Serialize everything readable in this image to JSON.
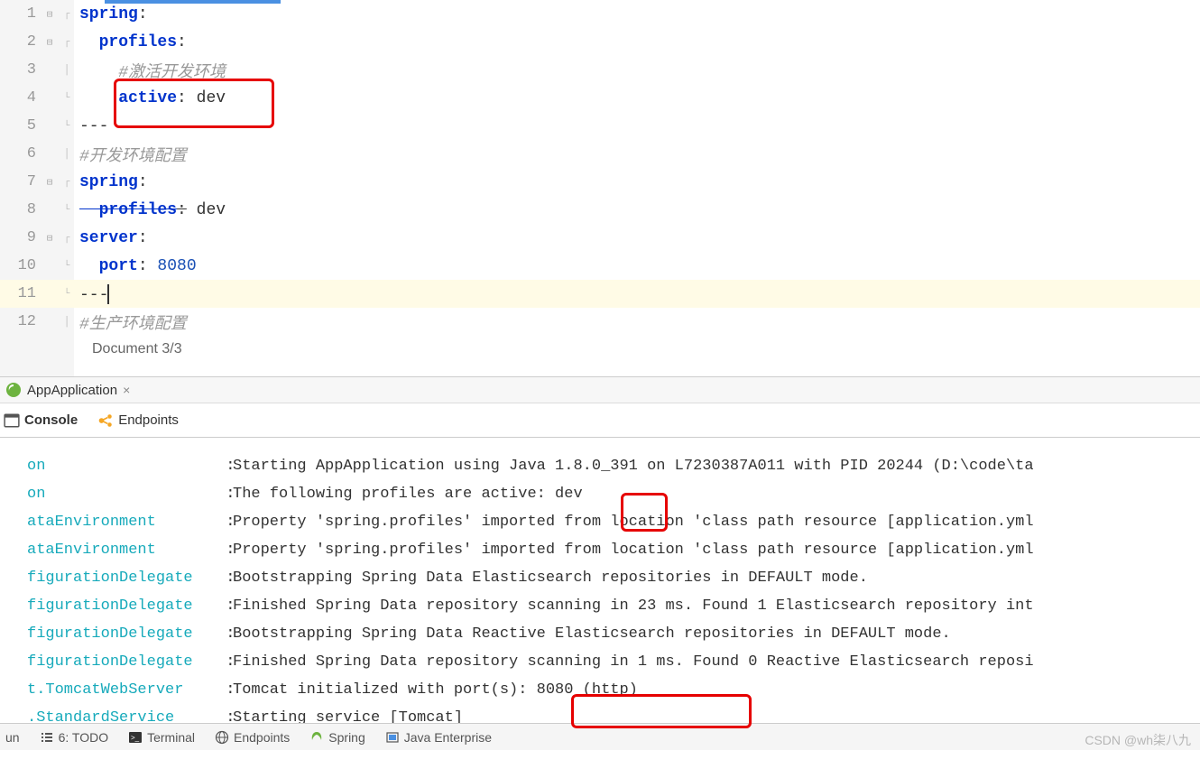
{
  "editor": {
    "lines": [
      {
        "n": "1",
        "type": "kv",
        "key": "spring",
        "indent": 0,
        "fold": "start"
      },
      {
        "n": "2",
        "type": "kv",
        "key": "profiles",
        "indent": 1,
        "fold": "start"
      },
      {
        "n": "3",
        "type": "comment",
        "text": "#激活开发环境",
        "indent": 2
      },
      {
        "n": "4",
        "type": "kv",
        "key": "active",
        "value": "dev",
        "indent": 2,
        "fold": "end"
      },
      {
        "n": "5",
        "type": "sep",
        "text": "---",
        "fold": "end"
      },
      {
        "n": "6",
        "type": "comment",
        "text": "#开发环境配置",
        "indent": 0
      },
      {
        "n": "7",
        "type": "kv",
        "key": "spring",
        "indent": 0,
        "fold": "start"
      },
      {
        "n": "8",
        "type": "kv",
        "key": "profiles",
        "value": "dev",
        "indent": 1,
        "strike": true,
        "fold": "end"
      },
      {
        "n": "9",
        "type": "kv",
        "key": "server",
        "indent": 0,
        "fold": "start"
      },
      {
        "n": "10",
        "type": "kv",
        "key": "port",
        "value": "8080",
        "num": true,
        "indent": 1,
        "fold": "end"
      },
      {
        "n": "11",
        "type": "sep",
        "text": "---",
        "cursor": true,
        "highlight": true,
        "fold": "end"
      },
      {
        "n": "12",
        "type": "comment",
        "text": "#生产环境配置",
        "indent": 0
      }
    ],
    "status": "Document 3/3"
  },
  "panel": {
    "title": "AppApplication",
    "tabs": {
      "console": "Console",
      "endpoints": "Endpoints"
    }
  },
  "console": [
    {
      "src": "on",
      "msg": "Starting AppApplication using Java 1.8.0_391 on L7230387A011 with PID 20244 (D:\\code\\ta"
    },
    {
      "src": "on",
      "msg": "The following profiles are active: dev"
    },
    {
      "src": "ataEnvironment",
      "msg": "Property 'spring.profiles' imported from location 'class path resource [application.yml"
    },
    {
      "src": "ataEnvironment",
      "msg": "Property 'spring.profiles' imported from location 'class path resource [application.yml"
    },
    {
      "src": "figurationDelegate",
      "msg": "Bootstrapping Spring Data Elasticsearch repositories in DEFAULT mode."
    },
    {
      "src": "figurationDelegate",
      "msg": "Finished Spring Data repository scanning in 23 ms. Found 1 Elasticsearch repository int"
    },
    {
      "src": "figurationDelegate",
      "msg": "Bootstrapping Spring Data Reactive Elasticsearch repositories in DEFAULT mode."
    },
    {
      "src": "figurationDelegate",
      "msg": "Finished Spring Data repository scanning in 1 ms. Found 0 Reactive Elasticsearch reposi"
    },
    {
      "src": "t.TomcatWebServer",
      "msg": "Tomcat initialized with port(s): 8080 (http)"
    },
    {
      "src": ".StandardService",
      "msg": "Starting service [Tomcat]"
    }
  ],
  "bottom": {
    "run": "un",
    "todo": "6: TODO",
    "terminal": "Terminal",
    "endpoints": "Endpoints",
    "spring": "Spring",
    "javaee": "Java Enterprise"
  },
  "watermark": "CSDN @wh柒八九"
}
